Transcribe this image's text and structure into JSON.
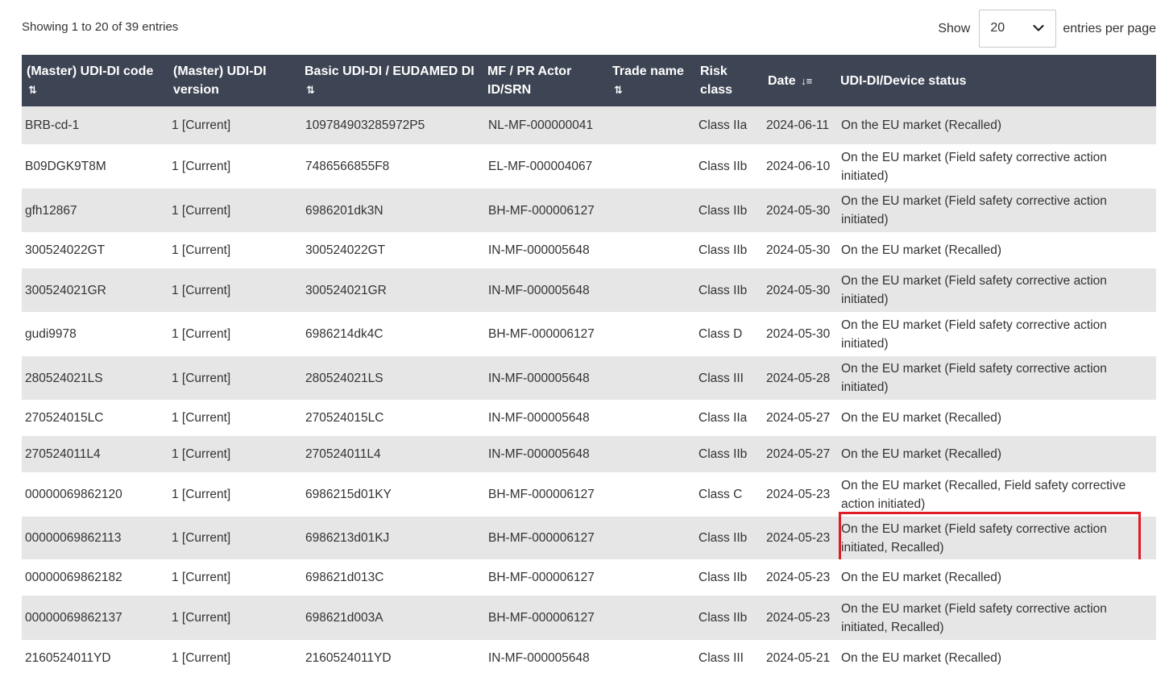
{
  "summary": "Showing 1 to 20 of 39 entries",
  "pagesize": {
    "show_label": "Show",
    "value": "20",
    "suffix": "entries per page"
  },
  "columns": {
    "code": "(Master) UDI-DI code",
    "version": "(Master) UDI-DI version",
    "basic": "Basic UDI-DI / EUDAMED DI",
    "actor": "MF / PR Actor ID/SRN",
    "trade": "Trade name",
    "risk": "Risk class",
    "date": "Date",
    "status": "UDI-DI/Device status"
  },
  "sort_icon": "⇅",
  "sort_desc_icon": "↓≡",
  "rows": [
    {
      "code": "BRB-cd-1",
      "version": "1 [Current]",
      "basic": "109784903285972P5",
      "actor": "NL-MF-000000041",
      "trade": "",
      "risk": "Class IIa",
      "date": "2024-06-11",
      "status": "On the EU market (Recalled)"
    },
    {
      "code": "B09DGK9T8M",
      "version": "1 [Current]",
      "basic": "7486566855F8",
      "actor": "EL-MF-000004067",
      "trade": "",
      "risk": "Class IIb",
      "date": "2024-06-10",
      "status": "On the EU market (Field safety corrective action initiated)"
    },
    {
      "code": "gfh12867",
      "version": "1 [Current]",
      "basic": "6986201dk3N",
      "actor": "BH-MF-000006127",
      "trade": "",
      "risk": "Class IIb",
      "date": "2024-05-30",
      "status": "On the EU market (Field safety corrective action initiated)"
    },
    {
      "code": "300524022GT",
      "version": "1 [Current]",
      "basic": "300524022GT",
      "actor": "IN-MF-000005648",
      "trade": "",
      "risk": "Class IIb",
      "date": "2024-05-30",
      "status": "On the EU market (Recalled)"
    },
    {
      "code": "300524021GR",
      "version": "1 [Current]",
      "basic": "300524021GR",
      "actor": "IN-MF-000005648",
      "trade": "",
      "risk": "Class IIb",
      "date": "2024-05-30",
      "status": "On the EU market (Field safety corrective action initiated)"
    },
    {
      "code": "gudi9978",
      "version": "1 [Current]",
      "basic": "6986214dk4C",
      "actor": "BH-MF-000006127",
      "trade": "",
      "risk": "Class D",
      "date": "2024-05-30",
      "status": "On the EU market (Field safety corrective action initiated)"
    },
    {
      "code": "280524021LS",
      "version": "1 [Current]",
      "basic": "280524021LS",
      "actor": "IN-MF-000005648",
      "trade": "",
      "risk": "Class III",
      "date": "2024-05-28",
      "status": "On the EU market (Field safety corrective action initiated)"
    },
    {
      "code": "270524015LC",
      "version": "1 [Current]",
      "basic": "270524015LC",
      "actor": "IN-MF-000005648",
      "trade": "",
      "risk": "Class IIa",
      "date": "2024-05-27",
      "status": "On the EU market (Recalled)"
    },
    {
      "code": "270524011L4",
      "version": "1 [Current]",
      "basic": "270524011L4",
      "actor": "IN-MF-000005648",
      "trade": "",
      "risk": "Class IIb",
      "date": "2024-05-27",
      "status": "On the EU market (Recalled)"
    },
    {
      "code": "00000069862120",
      "version": "1 [Current]",
      "basic": "6986215d01KY",
      "actor": "BH-MF-000006127",
      "trade": "",
      "risk": "Class C",
      "date": "2024-05-23",
      "status": "On the EU market (Recalled, Field safety corrective action initiated)"
    },
    {
      "code": "00000069862113",
      "version": "1 [Current]",
      "basic": "6986213d01KJ",
      "actor": "BH-MF-000006127",
      "trade": "",
      "risk": "Class IIb",
      "date": "2024-05-23",
      "status": "On the EU market (Field safety corrective action initiated, Recalled)",
      "highlight": true
    },
    {
      "code": "00000069862182",
      "version": "1 [Current]",
      "basic": "698621d013C",
      "actor": "BH-MF-000006127",
      "trade": "",
      "risk": "Class IIb",
      "date": "2024-05-23",
      "status": "On the EU market (Recalled)"
    },
    {
      "code": "00000069862137",
      "version": "1 [Current]",
      "basic": "698621d003A",
      "actor": "BH-MF-000006127",
      "trade": "",
      "risk": "Class IIb",
      "date": "2024-05-23",
      "status": "On the EU market (Field safety corrective action initiated, Recalled)"
    },
    {
      "code": "2160524011YD",
      "version": "1 [Current]",
      "basic": "2160524011YD",
      "actor": "IN-MF-000005648",
      "trade": "",
      "risk": "Class III",
      "date": "2024-05-21",
      "status": "On the EU market (Recalled)"
    }
  ],
  "colors": {
    "header_bg": "#3d4453",
    "stripe": "#e6e6e6",
    "highlight_border": "#e01d25"
  }
}
